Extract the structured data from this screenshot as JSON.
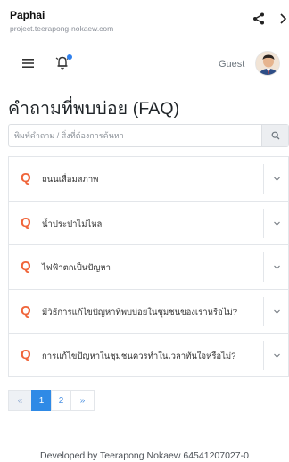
{
  "browser": {
    "app_title": "Paphai",
    "url": "project.teerapong-nokaew.com"
  },
  "header": {
    "user_label": "Guest",
    "notification_dot_color": "#2f80ed"
  },
  "page": {
    "title": "คำถามที่พบบ่อย (FAQ)"
  },
  "search": {
    "placeholder": "พิมพ์คำถาม / สิ่งที่ต้องการค้นหา",
    "value": ""
  },
  "faq": {
    "q_marker": "Q",
    "q_marker_color": "#f0653a",
    "items": [
      {
        "question": "ถนนเสื่อมสภาพ"
      },
      {
        "question": "น้ำประปาไม่ไหล"
      },
      {
        "question": "ไฟฟ้าตกเป็นปัญหา"
      },
      {
        "question": "มีวิธีการแก้ไขปัญหาที่พบบ่อยในชุมชนของเราหรือไม่?"
      },
      {
        "question": "การแก้ไขปัญหาในชุมชนควรทำในเวลาทันใจหรือไม่?"
      }
    ]
  },
  "pagination": {
    "prev_label": "«",
    "pages": [
      "1",
      "2"
    ],
    "current_page": "1",
    "next_label": "»"
  },
  "footer": {
    "text": "Developed by Teerapong Nokaew 64541207027-0"
  }
}
